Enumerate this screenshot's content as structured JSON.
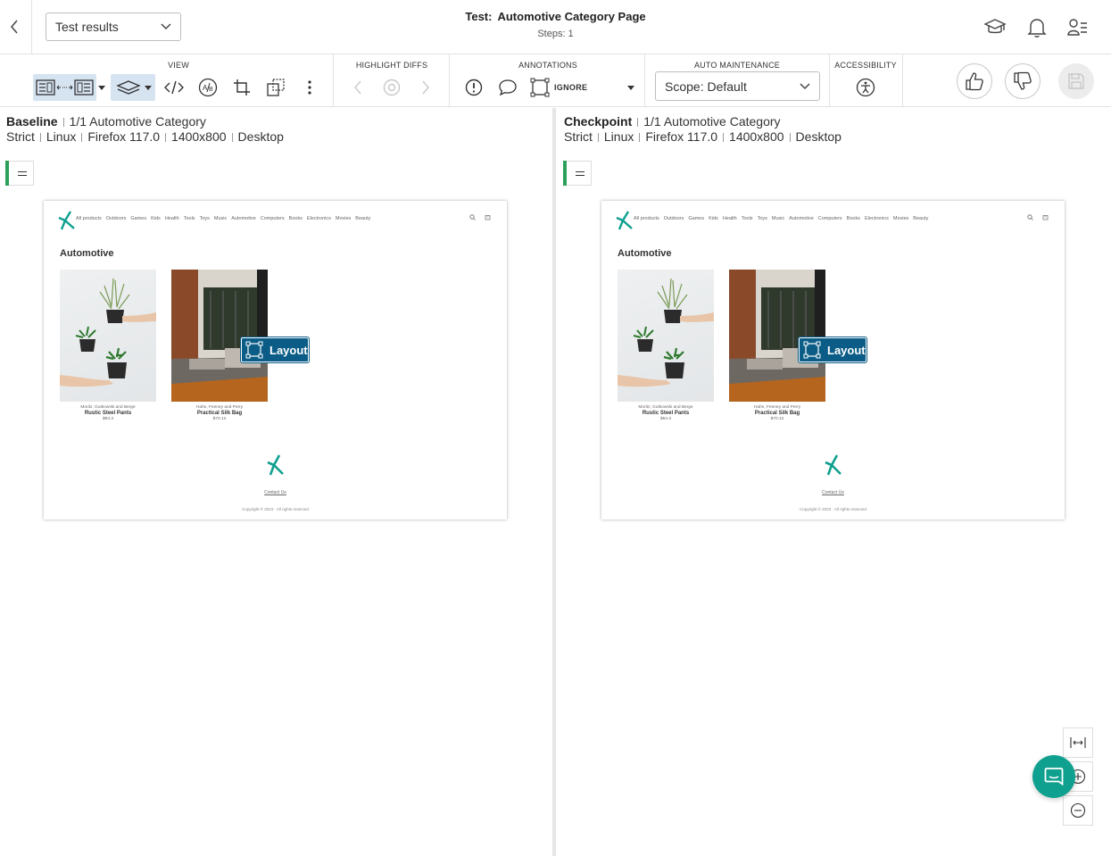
{
  "header": {
    "dropdown_value": "Test results",
    "title_prefix": "Test:",
    "title": "Automotive Category Page",
    "steps": "Steps: 1",
    "icons": [
      "chevron-left-icon",
      "graduation-cap-icon",
      "bell-icon",
      "user-list-icon"
    ]
  },
  "toolbar": {
    "groups": {
      "view": "VIEW",
      "highlight_diffs": "HIGHLIGHT DIFFS",
      "annotations": "ANNOTATIONS",
      "auto_maintenance": "AUTO MAINTENANCE",
      "accessibility": "ACCESSIBILITY"
    },
    "ignore_label": "IGNORE",
    "scope_value": "Scope: Default"
  },
  "baseline": {
    "label": "Baseline",
    "step": "1/1 Automotive Category",
    "meta": [
      "Strict",
      "Linux",
      "Firefox 117.0",
      "1400x800",
      "Desktop"
    ],
    "badge": "Layout"
  },
  "checkpoint": {
    "label": "Checkpoint",
    "step": "1/1 Automotive Category",
    "meta": [
      "Strict",
      "Linux",
      "Firefox 117.0",
      "1400x800",
      "Desktop"
    ],
    "badge": "Layout"
  },
  "screenshot": {
    "nav": [
      "All products",
      "Outdoors",
      "Games",
      "Kids",
      "Health",
      "Tools",
      "Toys",
      "Music",
      "Automotive",
      "Computers",
      "Books",
      "Electronics",
      "Movies",
      "Beauty"
    ],
    "heading": "Automotive",
    "products": [
      {
        "brand": "Moritz, Gutkowski and Berge",
        "name": "Rustic Steel Pants",
        "price": "$84.3"
      },
      {
        "brand": "Hahn, Feeney and Perry",
        "name": "Practical Silk Bag",
        "price": "$70.12"
      }
    ],
    "contact": "Contact Us",
    "copyright": "Copyright © 2023 · All rights reserved"
  },
  "colors": {
    "accent": "#0b5c86",
    "brand": "#0fa08f",
    "match": "#2ca05a"
  }
}
